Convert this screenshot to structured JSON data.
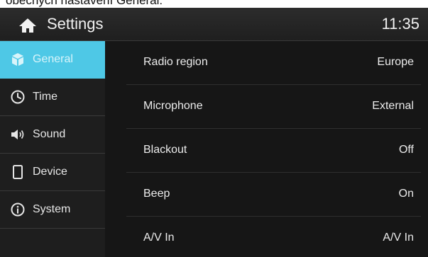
{
  "caption": "obecných nastavení General:",
  "header": {
    "title": "Settings",
    "clock": "11:35"
  },
  "colors": {
    "accent": "#4ec8e6",
    "background": "#161616"
  },
  "sidebar": {
    "items": [
      {
        "label": "General",
        "icon": "cube-icon",
        "active": true
      },
      {
        "label": "Time",
        "icon": "clock-icon",
        "active": false
      },
      {
        "label": "Sound",
        "icon": "speaker-icon",
        "active": false
      },
      {
        "label": "Device",
        "icon": "phone-icon",
        "active": false
      },
      {
        "label": "System",
        "icon": "info-icon",
        "active": false
      }
    ]
  },
  "settings": {
    "rows": [
      {
        "label": "Radio region",
        "value": "Europe"
      },
      {
        "label": "Microphone",
        "value": "External"
      },
      {
        "label": "Blackout",
        "value": "Off"
      },
      {
        "label": "Beep",
        "value": "On"
      },
      {
        "label": "A/V In",
        "value": "A/V In"
      }
    ]
  }
}
